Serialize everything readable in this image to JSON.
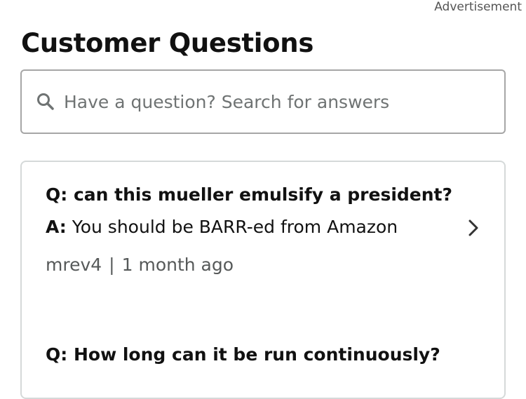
{
  "ad_label": "Advertisement",
  "section": {
    "title": "Customer Questions"
  },
  "search": {
    "placeholder": "Have a question? Search for answers",
    "icon": "search-icon"
  },
  "questions": [
    {
      "q_prefix": "Q:",
      "question": "can this mueller emulsify a president?",
      "a_prefix": "A:",
      "answer": "You should be BARR-ed from Amazon",
      "author": "mrev4",
      "separator": "|",
      "time": "1 month ago"
    },
    {
      "q_prefix": "Q:",
      "question": "How long can it be run continuously?"
    }
  ],
  "colors": {
    "border": "#a6a6a6",
    "card_border": "#d5d9d9",
    "meta_text": "#565959"
  }
}
